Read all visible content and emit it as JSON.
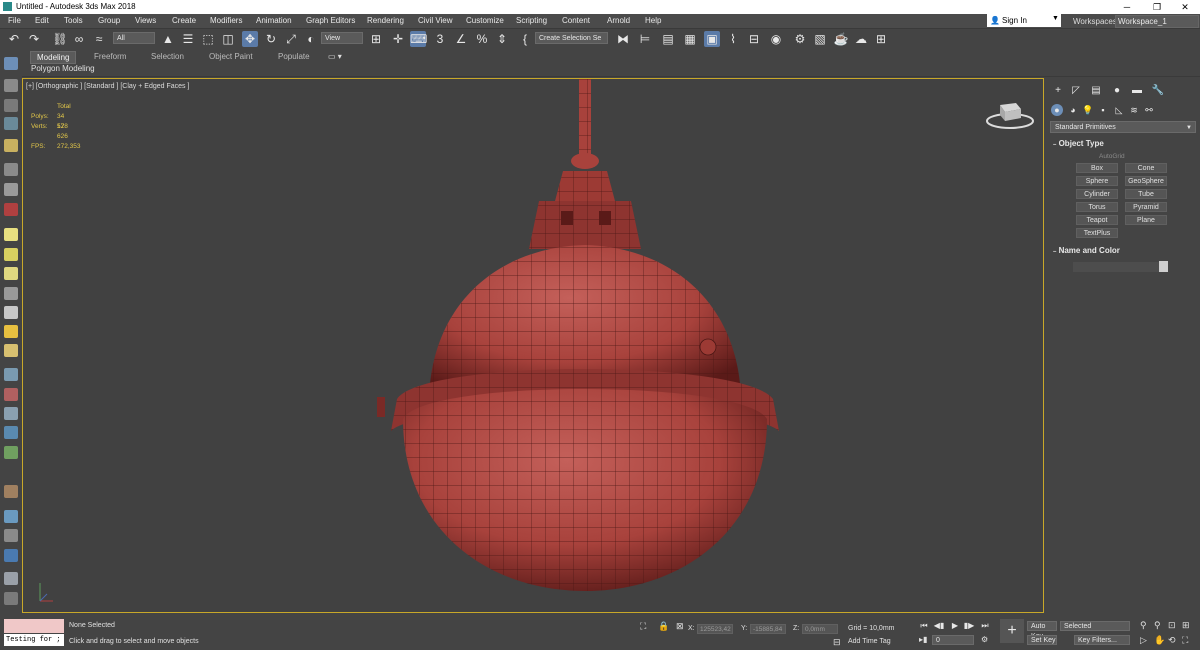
{
  "window": {
    "title": "Untitled - Autodesk 3ds Max 2018",
    "minimize": "─",
    "maximize": "❐",
    "close": "✕"
  },
  "menu": [
    "File",
    "Edit",
    "Tools",
    "Group",
    "Views",
    "Create",
    "Modifiers",
    "Animation",
    "Graph Editors",
    "Rendering",
    "Civil View",
    "Customize",
    "Scripting",
    "Content",
    "Arnold",
    "Help"
  ],
  "account": {
    "sign_in": "Sign In",
    "workspaces_label": "Workspaces:",
    "workspace": "Workspace_1"
  },
  "toolbar": {
    "selection_filter": "All",
    "reference_coord": "View",
    "selection_set": "Create Selection Se"
  },
  "ribbon": {
    "tabs": [
      "Modeling",
      "Freeform",
      "Selection",
      "Object Paint",
      "Populate"
    ],
    "active_tab": "Modeling",
    "panel": "Polygon Modeling"
  },
  "viewport": {
    "label": "[+] [Orthographic ] [Standard ] [Clay + Edged Faces ]",
    "stats": {
      "header": "Total",
      "polys_label": "Polys:",
      "polys": "34 528",
      "verts_label": "Verts:",
      "verts": "17 626",
      "fps_label": "FPS:",
      "fps": "272,353"
    }
  },
  "command_panel": {
    "category": "Standard Primitives",
    "object_type_title": "Object Type",
    "autogrid": "AutoGrid",
    "buttons": [
      "Box",
      "Cone",
      "Sphere",
      "GeoSphere",
      "Cylinder",
      "Tube",
      "Torus",
      "Pyramid",
      "Teapot",
      "Plane",
      "TextPlus"
    ],
    "name_color_title": "Name and Color"
  },
  "status": {
    "maxscript_text": "Testing for ;",
    "selection": "None Selected",
    "prompt": "Click and drag to select and move objects",
    "x_label": "X:",
    "x": "125523,42",
    "y_label": "Y:",
    "y": "-15885,84",
    "z_label": "Z:",
    "z": "0,0mm",
    "grid": "Grid = 10,0mm",
    "add_time_tag": "Add Time Tag",
    "frame": "0",
    "auto_key": "Auto Key",
    "set_key": "Set Key",
    "key_mode": "Selected",
    "key_filters": "Key Filters..."
  },
  "colors": {
    "viewport_border": "#c8a829",
    "model_red": "#b24a44",
    "active_tool": "#5b7ba8",
    "stats_text": "#e3c84a"
  }
}
